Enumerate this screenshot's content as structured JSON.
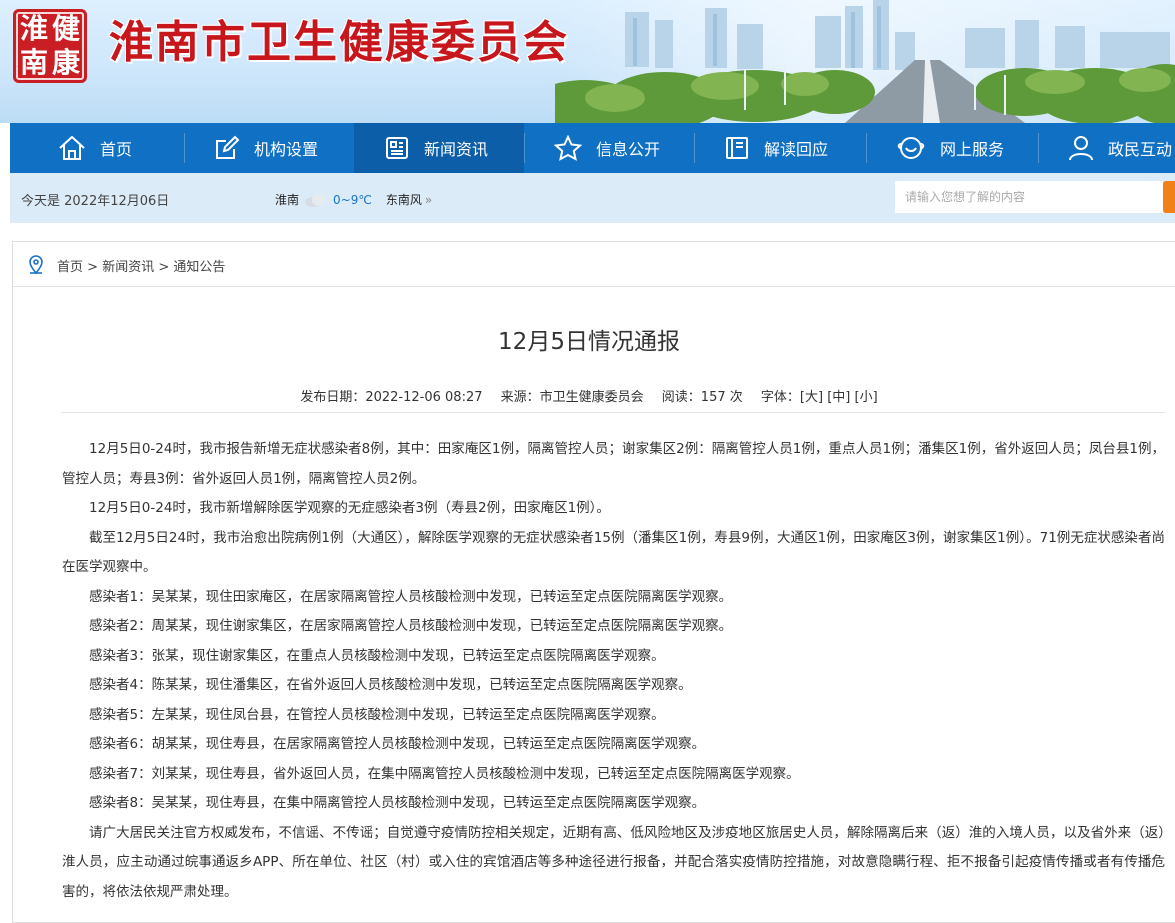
{
  "site": {
    "seal_chars": [
      "淮",
      "健",
      "南",
      "康"
    ],
    "title": "淮南市卫生健康委员会"
  },
  "nav": {
    "items": [
      {
        "label": "首页",
        "icon": "home-icon"
      },
      {
        "label": "机构设置",
        "icon": "edit-icon"
      },
      {
        "label": "新闻资讯",
        "icon": "news-icon",
        "active": true
      },
      {
        "label": "信息公开",
        "icon": "star-icon"
      },
      {
        "label": "解读回应",
        "icon": "book-icon"
      },
      {
        "label": "网上服务",
        "icon": "service-icon"
      },
      {
        "label": "政民互动",
        "icon": "user-icon"
      }
    ]
  },
  "infobar": {
    "today": "今天是 2022年12月06日",
    "weather_city": "淮南",
    "weather_temp": "0~9℃",
    "weather_wind": "东南风",
    "search_placeholder": "请输入您想了解的内容"
  },
  "breadcrumb": {
    "home": "首页",
    "sep": " > ",
    "level1": "新闻资讯",
    "level2": "通知公告"
  },
  "article": {
    "title": "12月5日情况通报",
    "publish_date": "发布日期：2022-12-06 08:27",
    "source": "来源：市卫生健康委员会",
    "reads": "阅读：157 次",
    "font_label": "字体：",
    "size_large": "[大]",
    "size_medium": "[中]",
    "size_small": "[小]",
    "paragraphs": [
      "12月5日0-24时，我市报告新增无症状感染者8例，其中：田家庵区1例，隔离管控人员；谢家集区2例：隔离管控人员1例，重点人员1例；潘集区1例，省外返回人员；凤台县1例，管控人员；寿县3例：省外返回人员1例，隔离管控人员2例。",
      "12月5日0-24时，我市新增解除医学观察的无症感染者3例（寿县2例，田家庵区1例）。",
      "截至12月5日24时，我市治愈出院病例1例（大通区），解除医学观察的无症状感染者15例（潘集区1例，寿县9例，大通区1例，田家庵区3例，谢家集区1例）。71例无症状感染者尚在医学观察中。",
      "感染者1：吴某某，现住田家庵区，在居家隔离管控人员核酸检测中发现，已转运至定点医院隔离医学观察。",
      "感染者2：周某某，现住谢家集区，在居家隔离管控人员核酸检测中发现，已转运至定点医院隔离医学观察。",
      "感染者3：张某，现住谢家集区，在重点人员核酸检测中发现，已转运至定点医院隔离医学观察。",
      "感染者4：陈某某，现住潘集区，在省外返回人员核酸检测中发现，已转运至定点医院隔离医学观察。",
      "感染者5：左某某，现住凤台县，在管控人员核酸检测中发现，已转运至定点医院隔离医学观察。",
      "感染者6：胡某某，现住寿县，在居家隔离管控人员核酸检测中发现，已转运至定点医院隔离医学观察。",
      "感染者7：刘某某，现住寿县，省外返回人员，在集中隔离管控人员核酸检测中发现，已转运至定点医院隔离医学观察。",
      "感染者8：吴某某，现住寿县，在集中隔离管控人员核酸检测中发现，已转运至定点医院隔离医学观察。",
      "请广大居民关注官方权威发布，不信谣、不传谣；自觉遵守疫情防控相关规定，近期有高、低风险地区及涉疫地区旅居史人员，解除隔离后来（返）淮的入境人员，以及省外来（返）淮人员，应主动通过皖事通返乡APP、所在单位、社区（村）或入住的宾馆酒店等多种途径进行报备，并配合落实疫情防控措施，对故意隐瞒行程、拒不报备引起疫情传播或者有传播危害的，将依法依规严肃处理。"
    ]
  }
}
